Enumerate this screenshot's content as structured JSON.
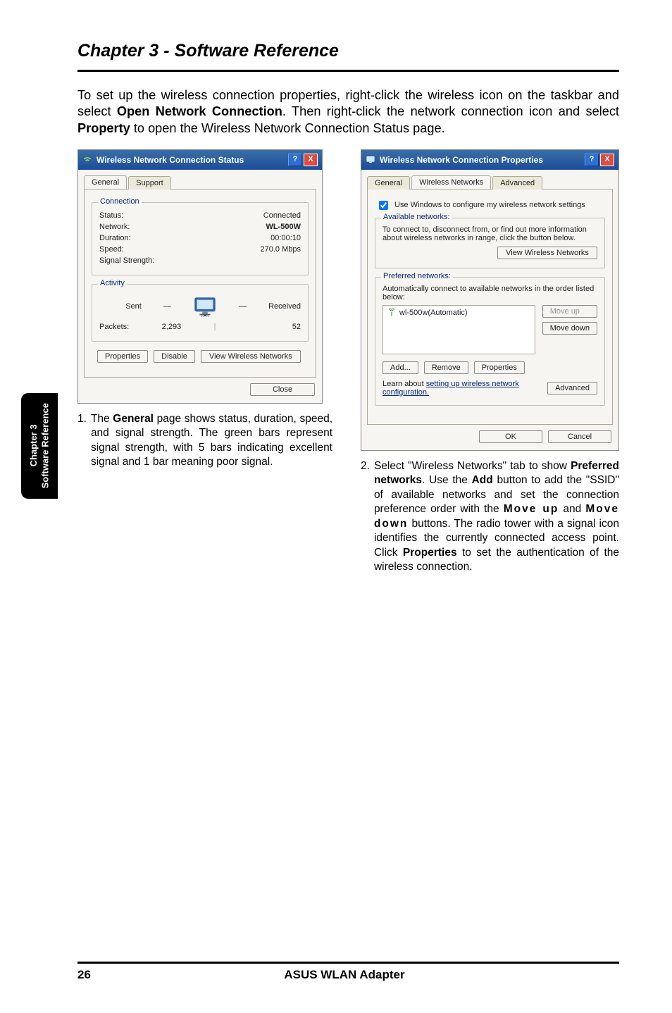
{
  "header": {
    "chapter_title": "Chapter 3 - Software Reference"
  },
  "intro_parts": {
    "p1": "To set up the wireless connection properties, right-click the wireless icon on the taskbar and select ",
    "b1": "Open Network Connection",
    "p2": ". Then right-click the network connection icon and select ",
    "b2": "Property",
    "p3": " to open the Wireless Network Connection Status page."
  },
  "dialog1": {
    "title": "Wireless Network Connection Status",
    "tabs": {
      "general": "General",
      "support": "Support"
    },
    "group_connection": "Connection",
    "status_label": "Status:",
    "status_value": "Connected",
    "network_label": "Network:",
    "network_value": "WL-500W",
    "duration_label": "Duration:",
    "duration_value": "00:00:10",
    "speed_label": "Speed:",
    "speed_value": "270.0 Mbps",
    "signal_label": "Signal Strength:",
    "group_activity": "Activity",
    "sent_label": "Sent",
    "received_label": "Received",
    "packets_label": "Packets:",
    "packets_sent": "2,293",
    "packets_received": "52",
    "btn_properties": "Properties",
    "btn_disable": "Disable",
    "btn_view": "View Wireless Networks",
    "btn_close": "Close"
  },
  "dialog2": {
    "title": "Wireless Network Connection Properties",
    "tabs": {
      "general": "General",
      "wireless": "Wireless Networks",
      "advanced": "Advanced"
    },
    "checkbox_label": "Use Windows to configure my wireless network settings",
    "group_available": "Available networks:",
    "available_desc": "To connect to, disconnect from, or find out more information about wireless networks in range, click the button below.",
    "btn_view_wireless": "View Wireless Networks",
    "group_preferred": "Preferred networks:",
    "preferred_desc": "Automatically connect to available networks in the order listed below:",
    "list_item": "wl-500w(Automatic)",
    "btn_moveup": "Move up",
    "btn_movedown": "Move down",
    "btn_add": "Add...",
    "btn_remove": "Remove",
    "btn_properties": "Properties",
    "learn_text": "Learn about ",
    "learn_link": "setting up wireless network configuration.",
    "btn_advanced": "Advanced",
    "btn_ok": "OK",
    "btn_cancel": "Cancel"
  },
  "captions": {
    "c1_num": "1.",
    "c1_a": " The ",
    "c1_b": "General",
    "c1_c": " page shows status, duration, speed, and signal strength. The green bars represent signal strength, with 5 bars indicating excellent signal and 1 bar meaning poor signal.",
    "c2_num": "2.",
    "c2_a": " Select \"Wireless Networks\" tab to show ",
    "c2_b": "Preferred networks",
    "c2_c": ". Use the ",
    "c2_d": "Add",
    "c2_e": " button to add the \"SSID\" of available networks and set the connection preference order with the ",
    "c2_f": "Move up",
    "c2_g": " and ",
    "c2_h": "Move down",
    "c2_i": " buttons. The radio tower with a signal icon identifies the currently connected access point. Click ",
    "c2_j": "Properties",
    "c2_k": " to set the authentication of the wireless connection."
  },
  "side_tab": {
    "line1": "Chapter 3",
    "line2": "Software Reference"
  },
  "footer": {
    "page_number": "26",
    "product": "ASUS WLAN Adapter"
  }
}
